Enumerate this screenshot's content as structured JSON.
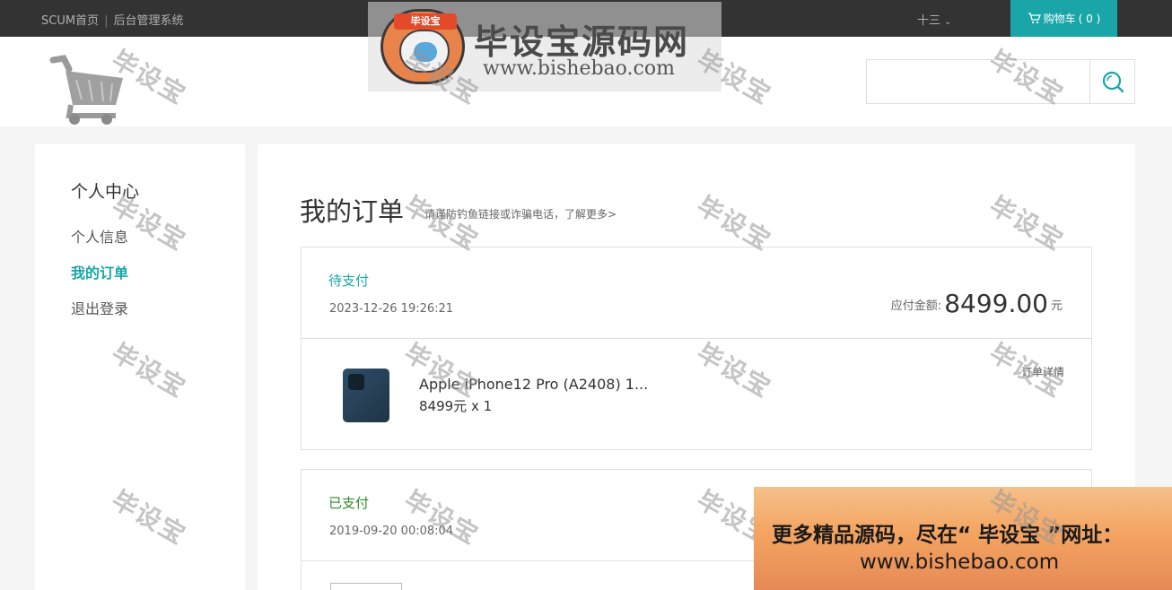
{
  "topbar": {
    "home_link": "SCUM首页",
    "admin_link": "后台管理系统",
    "username": "十三",
    "cart_label": "购物车",
    "cart_count": "( 0 )"
  },
  "search": {
    "placeholder": ""
  },
  "watermark": {
    "banner_badge": "毕设宝",
    "banner_title": "毕设宝源码网",
    "banner_url": "www.bishebao.com",
    "stamp_text": "毕设宝"
  },
  "sidebar": {
    "heading": "个人中心",
    "items": [
      {
        "label": "个人信息",
        "active": false
      },
      {
        "label": "我的订单",
        "active": true
      },
      {
        "label": "退出登录",
        "active": false
      }
    ]
  },
  "main": {
    "title": "我的订单",
    "tip": "请谨防钓鱼链接或诈骗电话，了解更多>"
  },
  "orders": [
    {
      "status": "待支付",
      "status_color": "#1aa6a8",
      "date": "2023-12-26 19:26:21",
      "amount_label": "应付金额:",
      "amount": "8499.00",
      "unit": "元",
      "detail_link": "订单详情",
      "product_name": "Apple iPhone12 Pro (A2408) 1...",
      "product_qty": "8499元 x 1"
    },
    {
      "status": "已支付",
      "status_color": "#2e8b2e",
      "date": "2019-09-20 00:08:04"
    }
  ],
  "promo": {
    "line1": "更多精品源码，尽在“ 毕设宝 ”网址：",
    "line2": "www.bishebao.com"
  },
  "colors": {
    "accent": "#1aa6a8",
    "topbar": "#333333"
  }
}
